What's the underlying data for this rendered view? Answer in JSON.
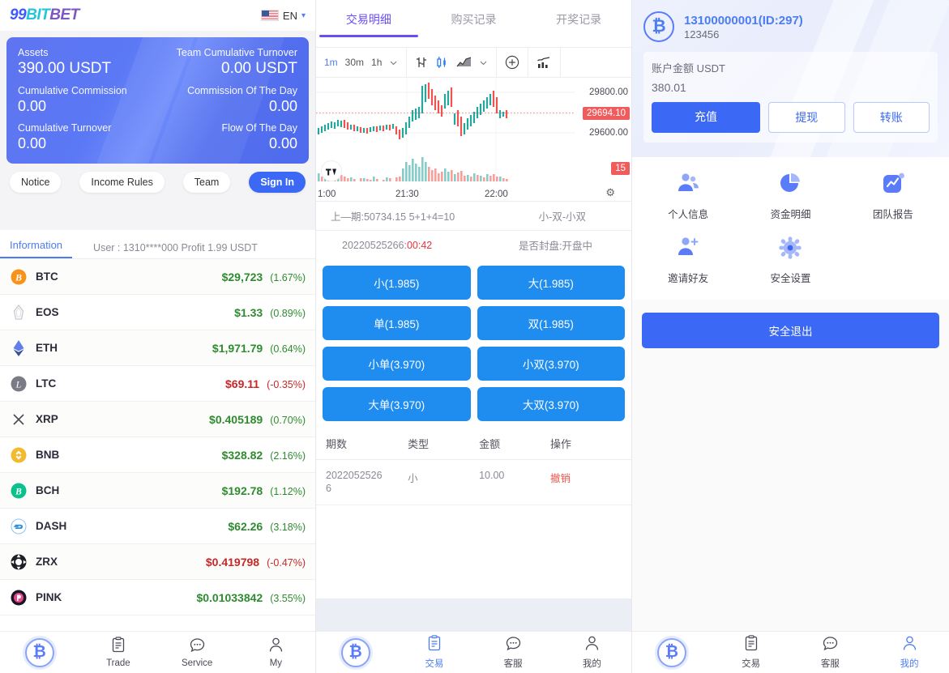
{
  "left": {
    "brand": {
      "part1": "99",
      "part2": "BIT",
      "part3": "BET"
    },
    "lang": {
      "label": "EN",
      "flag": "us-flag-icon",
      "chevron": "chevron-down-icon"
    },
    "asset_card": {
      "assets_label": "Assets",
      "assets_value": "390.00 USDT",
      "team_turnover_label": "Team Cumulative Turnover",
      "team_turnover_value": "0.00 USDT",
      "cumulative_commission_label": "Cumulative Commission",
      "cumulative_commission_value": "0.00",
      "commission_day_label": "Commission Of The Day",
      "commission_day_value": "0.00",
      "cumulative_turnover_label": "Cumulative Turnover",
      "cumulative_turnover_value": "0.00",
      "flow_day_label": "Flow Of The Day",
      "flow_day_value": "0.00"
    },
    "pills": [
      {
        "label": "Notice",
        "primary": false
      },
      {
        "label": "Income Rules",
        "primary": false
      },
      {
        "label": "Team",
        "primary": false
      },
      {
        "label": "Sign In",
        "primary": true
      }
    ],
    "info_tab": "Information",
    "info_user": "User : 1310****000 Profit 1.99 USDT",
    "coins": [
      {
        "symbol": "BTC",
        "icon": "btc-icon",
        "price": "$29,723",
        "change": "(1.67%)",
        "dir": "up"
      },
      {
        "symbol": "EOS",
        "icon": "eos-icon",
        "price": "$1.33",
        "change": "(0.89%)",
        "dir": "up"
      },
      {
        "symbol": "ETH",
        "icon": "eth-icon",
        "price": "$1,971.79",
        "change": "(0.64%)",
        "dir": "up"
      },
      {
        "symbol": "LTC",
        "icon": "ltc-icon",
        "price": "$69.11",
        "change": "(-0.35%)",
        "dir": "down"
      },
      {
        "symbol": "XRP",
        "icon": "xrp-icon",
        "price": "$0.405189",
        "change": "(0.70%)",
        "dir": "up"
      },
      {
        "symbol": "BNB",
        "icon": "bnb-icon",
        "price": "$328.82",
        "change": "(2.16%)",
        "dir": "up"
      },
      {
        "symbol": "BCH",
        "icon": "bch-icon",
        "price": "$192.78",
        "change": "(1.12%)",
        "dir": "up"
      },
      {
        "symbol": "DASH",
        "icon": "dash-icon",
        "price": "$62.26",
        "change": "(3.18%)",
        "dir": "up"
      },
      {
        "symbol": "ZRX",
        "icon": "zrx-icon",
        "price": "$0.419798",
        "change": "(-0.47%)",
        "dir": "down"
      },
      {
        "symbol": "PINK",
        "icon": "pink-icon",
        "price": "$0.01033842",
        "change": "(3.55%)",
        "dir": "up"
      }
    ],
    "bottom_nav": [
      {
        "label": "",
        "icon": "bitcoin-logo-icon",
        "active": false
      },
      {
        "label": "Trade",
        "icon": "clipboard-icon",
        "active": false
      },
      {
        "label": "Service",
        "icon": "chat-icon",
        "active": false
      },
      {
        "label": "My",
        "icon": "person-icon",
        "active": false
      }
    ]
  },
  "mid": {
    "tabs": [
      {
        "label": "交易明细",
        "active": true
      },
      {
        "label": "购买记录",
        "active": false
      },
      {
        "label": "开奖记录",
        "active": false
      }
    ],
    "toolbar": {
      "intervals": [
        {
          "label": "1m",
          "active": true
        },
        {
          "label": "30m",
          "active": false
        },
        {
          "label": "1h",
          "active": false
        }
      ],
      "chevron": "chevron-down-icon",
      "bars_icon": "bar-chart-icon",
      "candles_icon": "candlestick-icon",
      "line_icon": "line-chart-icon",
      "plus_icon": "plus-circle-icon",
      "indicator_icon": "indicators-icon"
    },
    "chart": {
      "price_labels": [
        "29800.00",
        "29600.00"
      ],
      "current_price": "29694.10",
      "countdown_badge": "15",
      "time_labels": [
        "1:00",
        "21:30",
        "22:00"
      ],
      "brand": "tradingview-icon",
      "gear": "settings-icon"
    },
    "round_info": {
      "last_label": "上—期:50734.15 5+1+4=10",
      "last_result": "小-双-小双",
      "period": "20220525266",
      "timer": "00:42",
      "status": "是否封盘:开盘中"
    },
    "bets": [
      {
        "label": "小(1.985)"
      },
      {
        "label": "大(1.985)"
      },
      {
        "label": "单(1.985)"
      },
      {
        "label": "双(1.985)"
      },
      {
        "label": "小单(3.970)"
      },
      {
        "label": "小双(3.970)"
      },
      {
        "label": "大单(3.970)"
      },
      {
        "label": "大双(3.970)"
      }
    ],
    "table": {
      "headers": [
        "期数",
        "类型",
        "金额",
        "操作"
      ],
      "rows": [
        {
          "period": "20220525266",
          "type": "小",
          "amount": "10.00",
          "action": "撤销"
        }
      ]
    },
    "bottom_nav": [
      {
        "label": "",
        "icon": "bitcoin-logo-icon",
        "active": false
      },
      {
        "label": "交易",
        "icon": "clipboard-icon",
        "active": true
      },
      {
        "label": "客服",
        "icon": "chat-icon",
        "active": false
      },
      {
        "label": "我的",
        "icon": "person-icon",
        "active": false
      }
    ]
  },
  "right": {
    "account": {
      "avatar": "bitcoin-avatar-icon",
      "username": "13100000001(ID:297)",
      "nickname": "123456",
      "balance_label": "账户金额 USDT",
      "balance_value": "380.01",
      "actions": [
        {
          "label": "充值",
          "style": "fill"
        },
        {
          "label": "提现",
          "style": "out"
        },
        {
          "label": "转账",
          "style": "out"
        }
      ]
    },
    "menu": [
      {
        "label": "个人信息",
        "icon": "people-icon"
      },
      {
        "label": "资金明细",
        "icon": "pie-chart-icon"
      },
      {
        "label": "团队报告",
        "icon": "report-chart-icon"
      },
      {
        "label": "邀请好友",
        "icon": "add-person-icon"
      },
      {
        "label": "安全设置",
        "icon": "gear-icon"
      }
    ],
    "logout": "安全退出",
    "bottom_nav": [
      {
        "label": "",
        "icon": "bitcoin-logo-icon",
        "active": false
      },
      {
        "label": "交易",
        "icon": "clipboard-icon",
        "active": false
      },
      {
        "label": "客服",
        "icon": "chat-icon",
        "active": false
      },
      {
        "label": "我的",
        "icon": "person-icon",
        "active": true
      }
    ]
  },
  "colors": {
    "accent_blue": "#3b68f5",
    "purple": "#6b4df6",
    "bet_blue": "#1f8cf0",
    "up_green": "#2e8b30",
    "down_red": "#c62828",
    "chart_red": "#f05c5c",
    "chart_green": "#26a69a"
  }
}
